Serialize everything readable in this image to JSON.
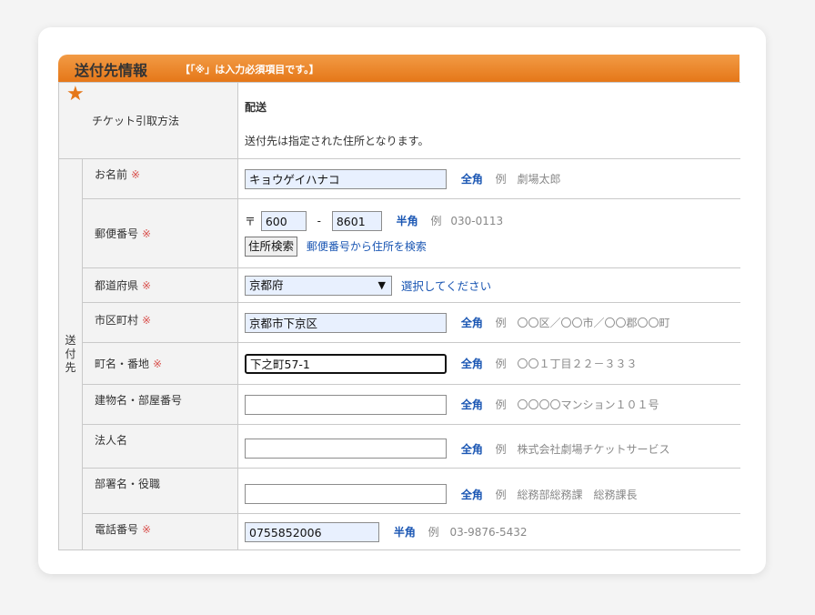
{
  "header": {
    "title": "送付先情報",
    "note": "【「※」は入力必須項目です。】"
  },
  "required_mark": "※",
  "side_label": [
    "送",
    "付",
    "先"
  ],
  "ticket": {
    "label": "チケット引取方法",
    "method": "配送",
    "description": "送付先は指定された住所となります。"
  },
  "rows": {
    "name": {
      "label": "お名前",
      "value": "キョウゲイハナコ",
      "kind": "全角",
      "ex_label": "例",
      "example": "劇場太郎"
    },
    "postal": {
      "label": "郵便番号",
      "mark": "〒",
      "value1": "600",
      "sep": "-",
      "value2": "8601",
      "kind": "半角",
      "ex_label": "例",
      "example": "030-0113",
      "search_button": "住所検索",
      "search_link": "郵便番号から住所を検索"
    },
    "prefecture": {
      "label": "都道府県",
      "value": "京都府",
      "hint": "選択してください"
    },
    "city": {
      "label": "市区町村",
      "value": "京都市下京区",
      "kind": "全角",
      "ex_label": "例",
      "example": "〇〇区／〇〇市／〇〇郡〇〇町"
    },
    "street": {
      "label": "町名・番地",
      "value": "下之町57-1",
      "kind": "全角",
      "ex_label": "例",
      "example": "〇〇１丁目２２－３３３"
    },
    "building": {
      "label": "建物名・部屋番号",
      "value": "",
      "kind": "全角",
      "ex_label": "例",
      "example": "〇〇〇〇マンション１０１号"
    },
    "company": {
      "label": "法人名",
      "value": "",
      "kind": "全角",
      "ex_label": "例",
      "example": "株式会社劇場チケットサービス"
    },
    "department": {
      "label": "部署名・役職",
      "value": "",
      "kind": "全角",
      "ex_label": "例",
      "example": "総務部総務課　総務課長"
    },
    "phone": {
      "label": "電話番号",
      "value": "0755852006",
      "kind": "半角",
      "ex_label": "例",
      "example": "03-9876-5432"
    }
  },
  "colors": {
    "header_orange": "#e57719",
    "required_red": "#d9534f",
    "link_blue": "#1a56b3"
  }
}
